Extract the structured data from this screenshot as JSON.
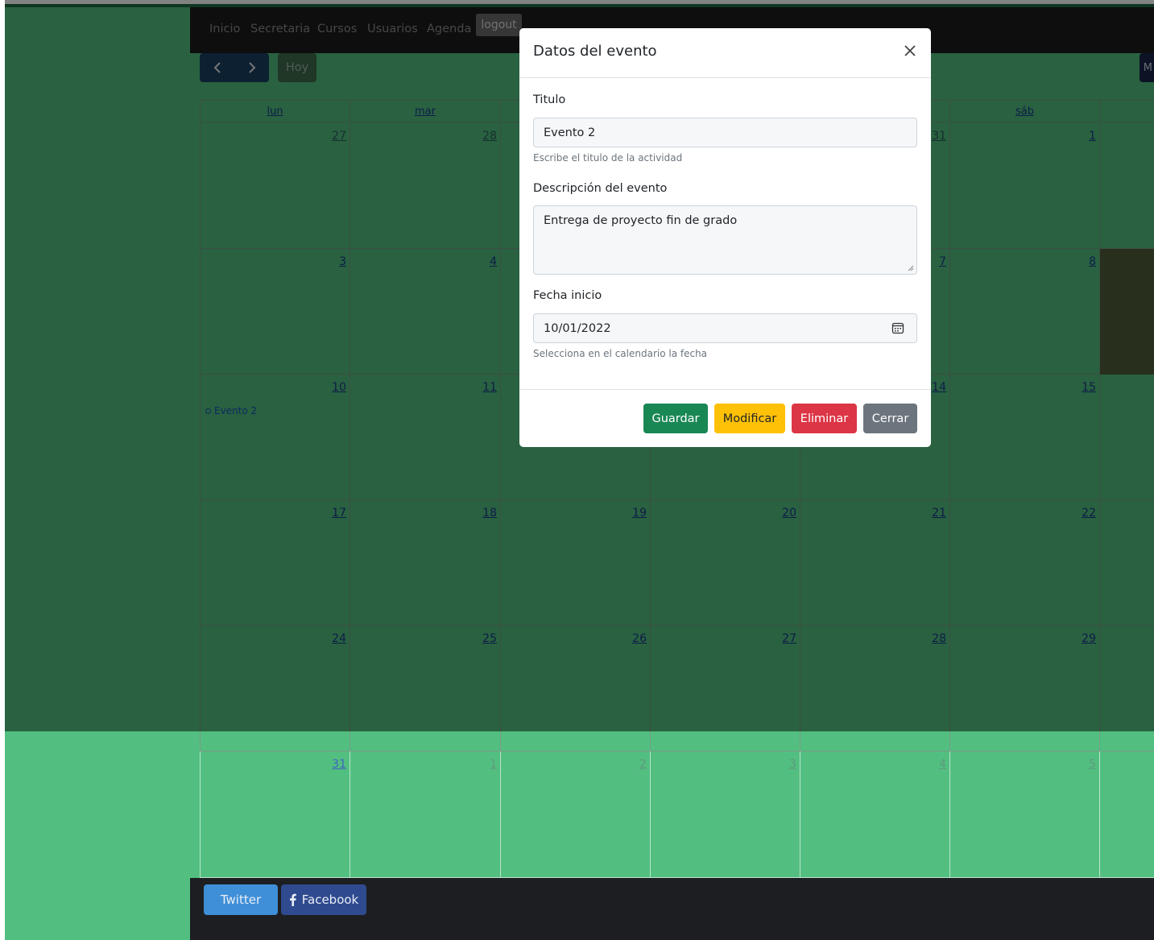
{
  "navbar": {
    "items": [
      "Inicio",
      "Secretaria",
      "Cursos",
      "Usuarios",
      "Agenda"
    ],
    "logout_label": "logout"
  },
  "toolbar": {
    "prev_icon": "chevron-left-icon",
    "next_icon": "chevron-right-icon",
    "today_label": "Hoy",
    "right_button_label": "M"
  },
  "calendar": {
    "headers": [
      "lun",
      "mar",
      "",
      "",
      "",
      "sáb",
      ""
    ],
    "weeks": [
      [
        "27",
        "28",
        "",
        "",
        "31",
        "1",
        ""
      ],
      [
        "3",
        "4",
        "",
        "",
        "7",
        "8",
        ""
      ],
      [
        "10",
        "11",
        "",
        "",
        "14",
        "15",
        ""
      ],
      [
        "17",
        "18",
        "19",
        "20",
        "21",
        "22",
        ""
      ],
      [
        "24",
        "25",
        "26",
        "27",
        "28",
        "29",
        ""
      ],
      [
        "31",
        "1",
        "2",
        "3",
        "4",
        "5",
        ""
      ]
    ],
    "event_label": "Evento 2"
  },
  "modal": {
    "title": "Datos del evento",
    "titulo_label": "Titulo",
    "titulo_value": "Evento 2",
    "titulo_help": "Escribe el titulo de la actividad",
    "descripcion_label": "Descripción del evento",
    "descripcion_value": "Entrega de proyecto fin de grado",
    "fecha_label": "Fecha inicio",
    "fecha_value": "10/01/2022",
    "fecha_help": "Selecciona en el calendario la fecha",
    "buttons": {
      "save": "Guardar",
      "edit": "Modificar",
      "delete": "Eliminar",
      "close": "Cerrar"
    }
  },
  "footer": {
    "twitter_label": "Twitter",
    "facebook_label": "Facebook"
  },
  "colors": {
    "page_bg": "#52bf80",
    "navbar_bg": "#1c1c1c",
    "save": "#198754",
    "edit": "#ffc107",
    "delete": "#dc3545",
    "close": "#6c757d",
    "twitter": "#3f8fd8",
    "facebook": "#2f4a8e"
  }
}
